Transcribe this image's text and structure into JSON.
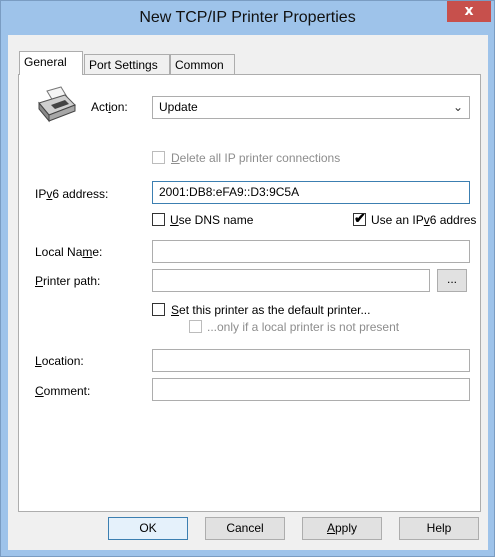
{
  "window": {
    "title": "New TCP/IP Printer Properties",
    "close_label": "x"
  },
  "tabs": [
    {
      "label": "General",
      "active": true
    },
    {
      "label": "Port Settings",
      "active": false
    },
    {
      "label": "Common",
      "active": false
    }
  ],
  "general": {
    "printer_icon": "printer-icon",
    "action": {
      "label_pre": "Act",
      "label_mnemonic": "i",
      "label_post": "on:",
      "value": "Update"
    },
    "delete_all": {
      "mnemonic": "D",
      "rest": "elete all IP printer connections",
      "checked": false,
      "disabled": true
    },
    "ipv6_address": {
      "label_pre": "IP",
      "label_mnemonic": "v",
      "label_post": "6 address:",
      "value": "2001:DB8:eFA9::D3:9C5A"
    },
    "use_dns": {
      "mnemonic": "U",
      "rest": "se DNS name",
      "checked": false
    },
    "use_ipv6": {
      "pre": "Use an IP",
      "mnemonic": "v",
      "post": "6 addres",
      "checked": true
    },
    "local_name": {
      "label_pre": "Local Na",
      "label_mnemonic": "m",
      "label_post": "e:",
      "value": ""
    },
    "printer_path": {
      "label_mnemonic": "P",
      "label_post": "rinter path:",
      "value": "",
      "browse_label": "..."
    },
    "set_default": {
      "mnemonic": "S",
      "rest": "et this printer as the default printer...",
      "checked": false
    },
    "only_if_local": {
      "text": "...only if a local printer is not present",
      "checked": false,
      "disabled": true
    },
    "location": {
      "label_mnemonic": "L",
      "label_post": "ocation:",
      "value": ""
    },
    "comment": {
      "label_mnemonic": "C",
      "label_post": "omment:",
      "value": ""
    }
  },
  "buttons": {
    "ok": "OK",
    "cancel": "Cancel",
    "apply_mnemonic": "A",
    "apply_rest": "pply",
    "help": "Help"
  }
}
